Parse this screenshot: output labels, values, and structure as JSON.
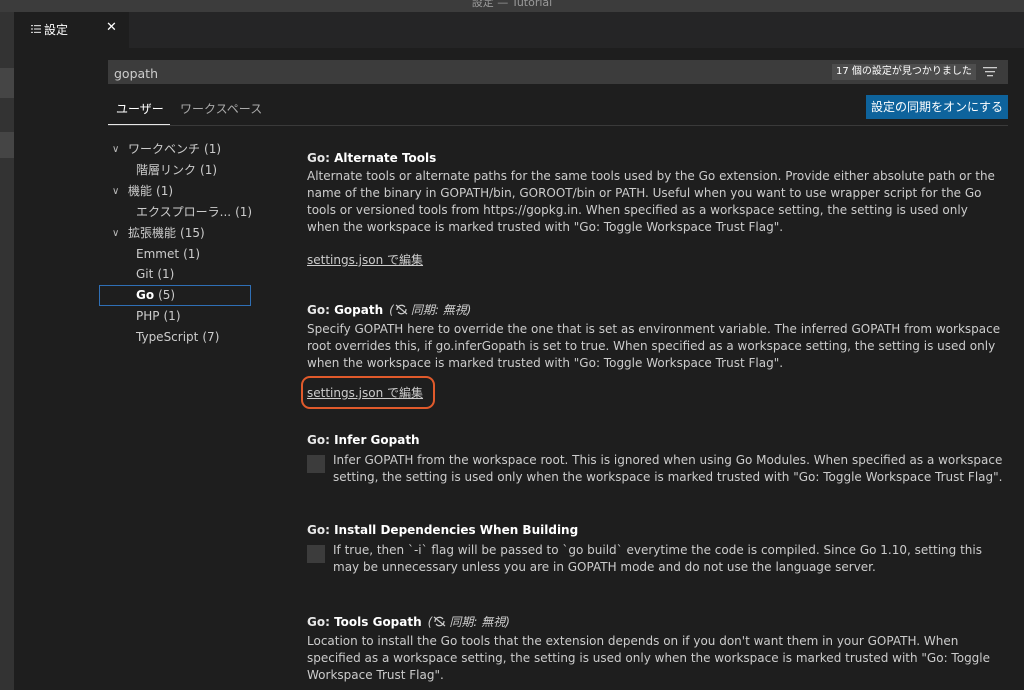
{
  "window": {
    "title": "設定 — Tutorial"
  },
  "tab": {
    "label": "設定",
    "icon": "settings-list-icon",
    "close_icon": "close-icon"
  },
  "search": {
    "value": "gopath",
    "result_count": "17 個の設定が見つかりました",
    "filter_icon": "filter-icon"
  },
  "scope_tabs": {
    "user": "ユーザー",
    "workspace": "ワークスペース"
  },
  "sync_button": "設定の同期をオンにする",
  "toc": [
    {
      "label": "ワークベンチ",
      "count": "(1)",
      "expanded": true
    },
    {
      "label": "階層リンク",
      "count": "(1)"
    },
    {
      "label": "機能",
      "count": "(1)",
      "expanded": true
    },
    {
      "label": "エクスプローラ...",
      "count": "(1)"
    },
    {
      "label": "拡張機能",
      "count": "(15)",
      "expanded": true
    },
    {
      "label": "Emmet",
      "count": "(1)"
    },
    {
      "label": "Git",
      "count": "(1)"
    },
    {
      "label": "Go",
      "count": "(5)",
      "selected": true
    },
    {
      "label": "PHP",
      "count": "(1)"
    },
    {
      "label": "TypeScript",
      "count": "(7)"
    }
  ],
  "settings": [
    {
      "category": "Go: ",
      "name": "Alternate Tools",
      "description": "Alternate tools or alternate paths for the same tools used by the Go extension. Provide either absolute path or the name of the binary in GOPATH/bin, GOROOT/bin or PATH. Useful when you want to use wrapper script for the Go tools or versioned tools from https://gopkg.in. When specified as a workspace setting, the setting is used only when the workspace is marked trusted with \"Go: Toggle Workspace Trust Flag\".",
      "link": "settings.json で編集"
    },
    {
      "category": "Go: ",
      "name": "Gopath",
      "sync": "同期: 無視)",
      "sync_prefix": "(",
      "description": "Specify GOPATH here to override the one that is set as environment variable. The inferred GOPATH from workspace root overrides this, if go.inferGopath is set to true. When specified as a workspace setting, the setting is used only when the workspace is marked trusted with \"Go: Toggle Workspace Trust Flag\".",
      "link": "settings.json で編集"
    },
    {
      "category": "Go: ",
      "name": "Infer Gopath",
      "description": "Infer GOPATH from the workspace root. This is ignored when using Go Modules. When specified as a workspace setting, the setting is used only when the workspace is marked trusted with \"Go: Toggle Workspace Trust Flag\".",
      "checked": false
    },
    {
      "category": "Go: ",
      "name": "Install Dependencies When Building",
      "description": "If true, then `-i` flag will be passed to `go build` everytime the code is compiled. Since Go 1.10, setting this may be unnecessary unless you are in GOPATH mode and do not use the language server.",
      "checked": false
    },
    {
      "category": "Go: ",
      "name": "Tools Gopath",
      "sync": "同期: 無視)",
      "sync_prefix": "(",
      "description": "Location to install the Go tools that the extension depends on if you don't want them in your GOPATH. When specified as a workspace setting, the setting is used only when the workspace is marked trusted with \"Go: Toggle Workspace Trust Flag\"."
    }
  ],
  "colors": {
    "accent": "#0e639c",
    "highlight": "#e05a2b",
    "selection": "#2f6fb5"
  }
}
